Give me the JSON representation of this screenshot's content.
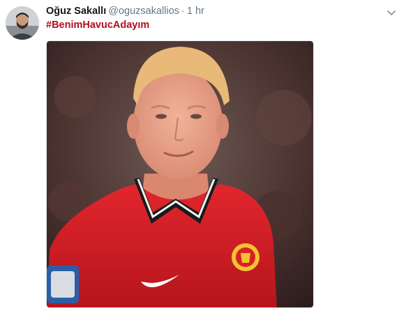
{
  "tweet": {
    "display_name": "Oğuz Sakallı",
    "handle": "@oguzsakallios",
    "separator": "·",
    "time": "1 hr",
    "hashtag": "#BenimHavucAdayım"
  },
  "icons": {
    "more": "chevron-down-icon"
  },
  "colors": {
    "hashtag": "#b10e1e",
    "name": "#14171a",
    "meta": "#657786",
    "jersey": "#d91f26"
  }
}
